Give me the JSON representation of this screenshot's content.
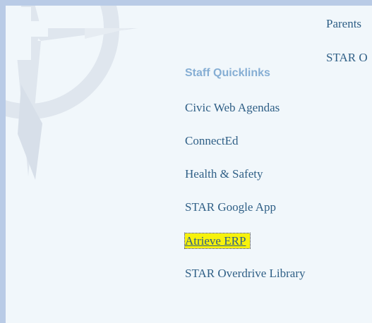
{
  "top_links": {
    "parents": "Parents",
    "star_o": "STAR O"
  },
  "quicklinks": {
    "heading": "Staff Quicklinks",
    "items": [
      {
        "label": "Civic Web Agendas"
      },
      {
        "label": "ConnectEd"
      },
      {
        "label": "Health & Safety"
      },
      {
        "label": "STAR Google App"
      },
      {
        "label": "Atrieve ERP",
        "focused": true
      },
      {
        "label": "STAR Overdrive Library"
      }
    ]
  },
  "colors": {
    "page_background": "#f1f7fb",
    "outer_background": "#b9cbe6",
    "link": "#2f5f86",
    "heading": "#86aed4",
    "highlight": "#f7f20c"
  }
}
